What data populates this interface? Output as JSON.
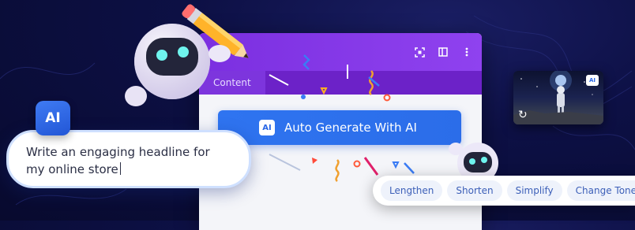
{
  "panel": {
    "tab_label": "Content",
    "icons": [
      "focus-icon",
      "columns-icon",
      "more-icon"
    ]
  },
  "ai_button": {
    "badge": "AI",
    "label": "Auto Generate With AI"
  },
  "prompt": {
    "badge": "AI",
    "text": "Write an engaging headline for my online store"
  },
  "actions": {
    "items": [
      "Lengthen",
      "Shorten",
      "Simplify",
      "Change Tone"
    ]
  },
  "thumbnail": {
    "badge": "AI",
    "icon": "regenerate-icon"
  },
  "colors": {
    "accent_purple": "#7b2fe0",
    "button_blue": "#2f74f0",
    "background_navy": "#0d1045"
  }
}
